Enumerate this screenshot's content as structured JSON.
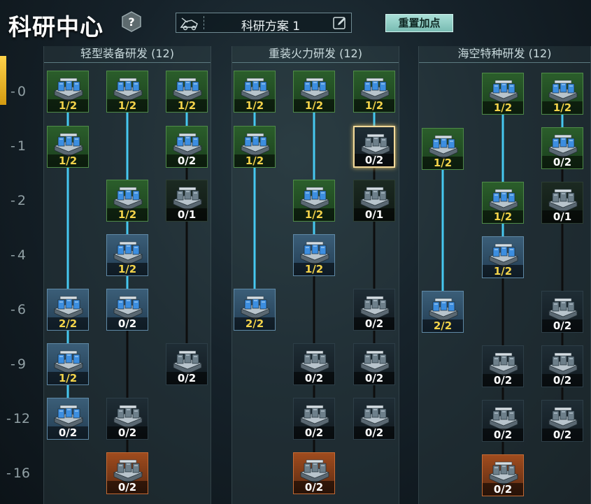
{
  "header": {
    "title": "科研中心",
    "help_icon": "question-icon",
    "plan_name": "科研方案 1",
    "plan_icon": "vehicle-icon",
    "edit_icon": "edit-icon",
    "reset_label": "重置加点"
  },
  "row_labels": [
    "0",
    "1",
    "2",
    "4",
    "6",
    "9",
    "12",
    "16"
  ],
  "branches": [
    {
      "name": "轻型装备研发 (12)"
    },
    {
      "name": "重装火力研发 (12)"
    },
    {
      "name": "海空特种研发 (12)"
    }
  ],
  "colors": {
    "line_active": "#46c8f0",
    "line_inactive": "#1a1a1a",
    "count_active": "#f3d34a",
    "count_inactive": "#ffffff",
    "reset_button": "#8fcfc6"
  },
  "tiles": [
    {
      "id": "t1",
      "count": "1/2",
      "state": "green"
    },
    {
      "id": "t2",
      "count": "1/2",
      "state": "green"
    },
    {
      "id": "t3",
      "count": "1/2",
      "state": "green"
    },
    {
      "id": "t4",
      "count": "1/2",
      "state": "green"
    },
    {
      "id": "t5",
      "count": "0/2",
      "state": "green"
    },
    {
      "id": "t6",
      "count": "1/2",
      "state": "green"
    },
    {
      "id": "t7",
      "count": "0/1",
      "state": "darkgreen"
    },
    {
      "id": "t8",
      "count": "1/2",
      "state": "blue"
    },
    {
      "id": "t9",
      "count": "2/2",
      "state": "blue"
    },
    {
      "id": "t10",
      "count": "0/2",
      "state": "blue"
    },
    {
      "id": "t11",
      "count": "1/2",
      "state": "blue"
    },
    {
      "id": "t12",
      "count": "0/2",
      "state": "dark"
    },
    {
      "id": "t13",
      "count": "0/2",
      "state": "blue"
    },
    {
      "id": "t14",
      "count": "0/2",
      "state": "dark"
    },
    {
      "id": "t15",
      "count": "0/2",
      "state": "orange"
    },
    {
      "id": "t16",
      "count": "1/2",
      "state": "green"
    },
    {
      "id": "t17",
      "count": "1/2",
      "state": "green"
    },
    {
      "id": "t18",
      "count": "1/2",
      "state": "green"
    },
    {
      "id": "t19",
      "count": "1/2",
      "state": "green"
    },
    {
      "id": "t20",
      "count": "0/2",
      "state": "dark",
      "selected": true
    },
    {
      "id": "t21",
      "count": "1/2",
      "state": "green"
    },
    {
      "id": "t22",
      "count": "0/1",
      "state": "darkgreen"
    },
    {
      "id": "t23",
      "count": "1/2",
      "state": "blue"
    },
    {
      "id": "t24",
      "count": "2/2",
      "state": "blue"
    },
    {
      "id": "t25",
      "count": "0/2",
      "state": "dark"
    },
    {
      "id": "t26",
      "count": "0/2",
      "state": "dark"
    },
    {
      "id": "t27",
      "count": "0/2",
      "state": "dark"
    },
    {
      "id": "t28",
      "count": "0/2",
      "state": "dark"
    },
    {
      "id": "t29",
      "count": "0/2",
      "state": "dark"
    },
    {
      "id": "t30",
      "count": "0/2",
      "state": "orange"
    },
    {
      "id": "t31",
      "count": "1/2",
      "state": "green"
    },
    {
      "id": "t32",
      "count": "1/2",
      "state": "green"
    },
    {
      "id": "t33",
      "count": "1/2",
      "state": "green"
    },
    {
      "id": "t34",
      "count": "0/2",
      "state": "green"
    },
    {
      "id": "t35",
      "count": "1/2",
      "state": "green"
    },
    {
      "id": "t36",
      "count": "0/1",
      "state": "darkgreen"
    },
    {
      "id": "t37",
      "count": "1/2",
      "state": "blue"
    },
    {
      "id": "t38",
      "count": "2/2",
      "state": "blue"
    },
    {
      "id": "t39",
      "count": "0/2",
      "state": "dark"
    },
    {
      "id": "t40",
      "count": "0/2",
      "state": "dark"
    },
    {
      "id": "t41",
      "count": "0/2",
      "state": "dark"
    },
    {
      "id": "t42",
      "count": "0/2",
      "state": "dark"
    },
    {
      "id": "t43",
      "count": "0/2",
      "state": "dark"
    },
    {
      "id": "t44",
      "count": "0/2",
      "state": "orange"
    }
  ]
}
